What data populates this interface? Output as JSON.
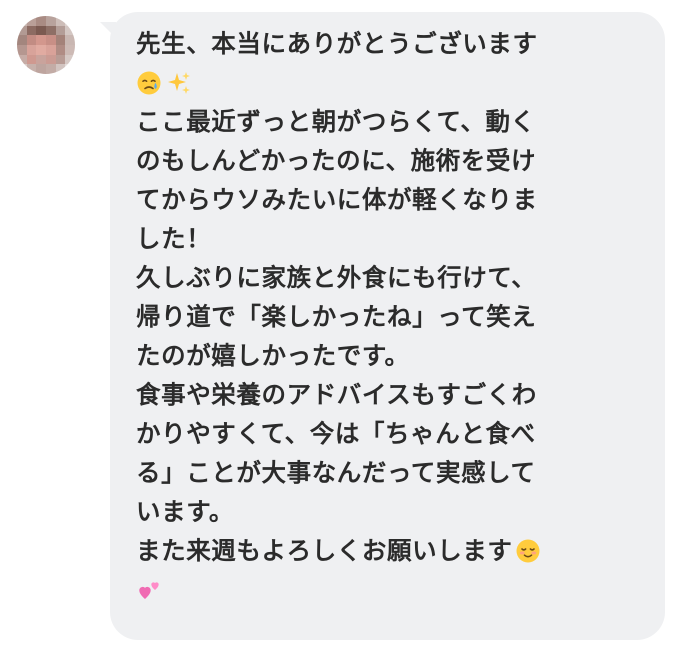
{
  "message": {
    "lines": [
      "先生、本当にありがとうございます",
      "",
      "ここ最近ずっと朝がつらくて、動く",
      "のもしんどかったのに、施術を受け",
      "てからウソみたいに体が軽くなりま",
      "した！",
      "久しぶりに家族と外食にも行けて、",
      "帰り道で「楽しかったね」って笑え",
      "たのが嬉しかったです。",
      "食事や栄養のアドバイスもすごくわ",
      "かりやすくて、今は「ちゃんと食べ",
      "る」ことが大事なんだって実感して",
      "います。",
      "また来週もよろしくお願いします",
      ""
    ]
  },
  "emojis": {
    "line2": [
      "crying-face-icon",
      "sparkles-icon"
    ],
    "line14_end": [
      "smiling-blush-face-icon"
    ],
    "line15": [
      "two-hearts-icon"
    ]
  },
  "colors": {
    "bubble": "#eff0f2",
    "text": "#2b2b2b",
    "background": "#ffffff"
  }
}
